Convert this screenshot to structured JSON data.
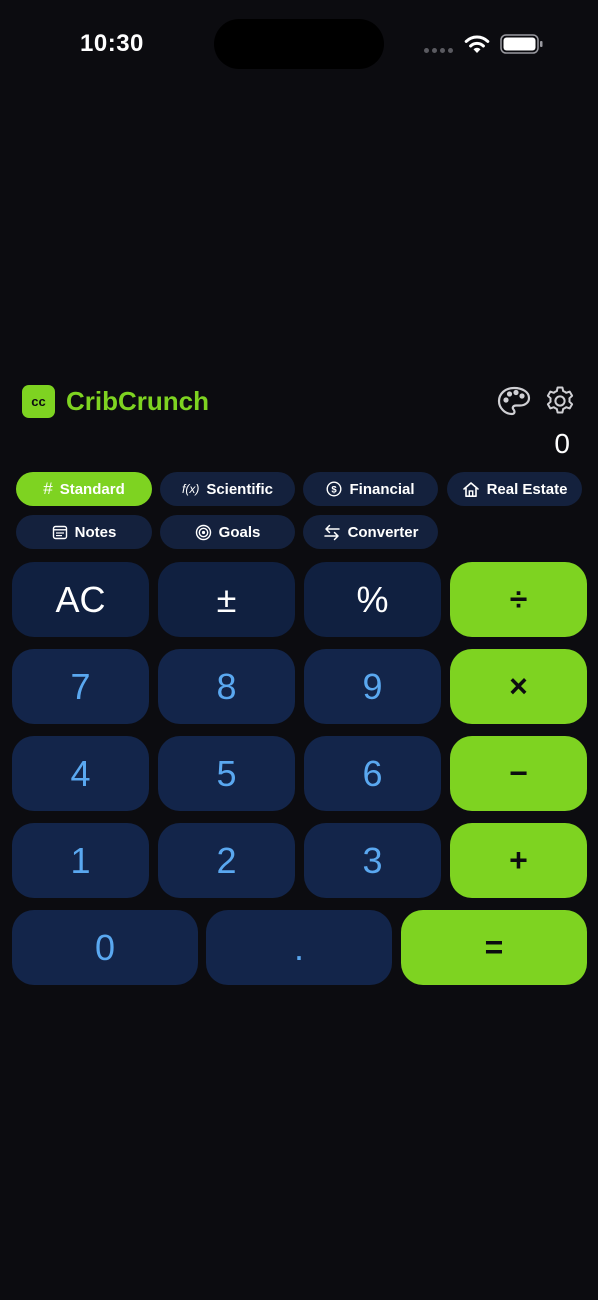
{
  "status": {
    "time": "10:30"
  },
  "header": {
    "logo_text": "cc",
    "title": "CribCrunch",
    "display": "0"
  },
  "tabs": [
    {
      "label": "Standard",
      "icon": "hash-icon",
      "active": true
    },
    {
      "label": "Scientific",
      "icon": "function-icon",
      "prefix": "f(x)",
      "active": false
    },
    {
      "label": "Financial",
      "icon": "dollar-coin-icon",
      "active": false
    },
    {
      "label": "Real Estate",
      "icon": "house-icon",
      "active": false
    },
    {
      "label": "Notes",
      "icon": "notepad-icon",
      "active": false
    },
    {
      "label": "Goals",
      "icon": "target-icon",
      "active": false
    },
    {
      "label": "Converter",
      "icon": "swap-arrows-icon",
      "active": false
    }
  ],
  "keypad": {
    "clear": "AC",
    "sign": "±",
    "percent": "%",
    "divide": "÷",
    "seven": "7",
    "eight": "8",
    "nine": "9",
    "multiply": "×",
    "four": "4",
    "five": "5",
    "six": "6",
    "subtract": "−",
    "one": "1",
    "two": "2",
    "three": "3",
    "add": "+",
    "zero": "0",
    "decimal": ".",
    "equals": "="
  },
  "colors": {
    "accent": "#7ed321",
    "key_bg": "#13254a",
    "digit_text": "#5aa8f0",
    "background": "#0c0c10"
  }
}
